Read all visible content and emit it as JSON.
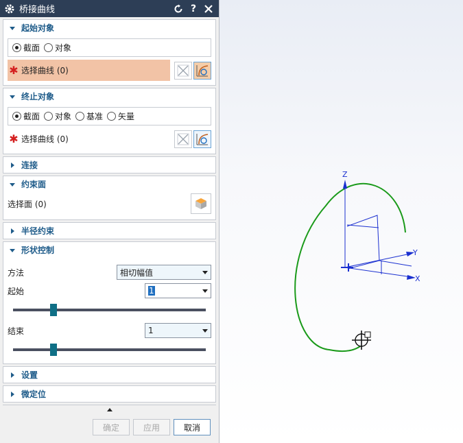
{
  "window": {
    "title": "桥接曲线"
  },
  "sections": {
    "start": {
      "title": "起始对象",
      "radios": [
        {
          "label": "截面",
          "checked": true
        },
        {
          "label": "对象",
          "checked": false
        }
      ],
      "select_label": "选择曲线 (0)"
    },
    "end": {
      "title": "终止对象",
      "radios": [
        {
          "label": "截面",
          "checked": true
        },
        {
          "label": "对象",
          "checked": false
        },
        {
          "label": "基准",
          "checked": false
        },
        {
          "label": "矢量",
          "checked": false
        }
      ],
      "select_label": "选择曲线 (0)"
    },
    "connect": {
      "title": "连接"
    },
    "constraint_face": {
      "title": "约束面",
      "select_label": "选择面 (0)"
    },
    "radius": {
      "title": "半径约束"
    },
    "shape": {
      "title": "形状控制",
      "method_label": "方法",
      "method_value": "相切幅值",
      "start_label": "起始",
      "start_value": "1",
      "start_slider_fraction": 0.2,
      "end_label": "结束",
      "end_value": "1",
      "end_slider_fraction": 0.2
    },
    "settings": {
      "title": "设置"
    },
    "fine": {
      "title": "微定位"
    }
  },
  "buttons": {
    "ok": "确定",
    "apply": "应用",
    "cancel": "取消"
  },
  "viewport": {
    "axis_z": "Z",
    "axis_y": "Y",
    "axis_x": "X",
    "curve_color": "#1a9a1a",
    "axis_color": "#1a2fd0"
  }
}
